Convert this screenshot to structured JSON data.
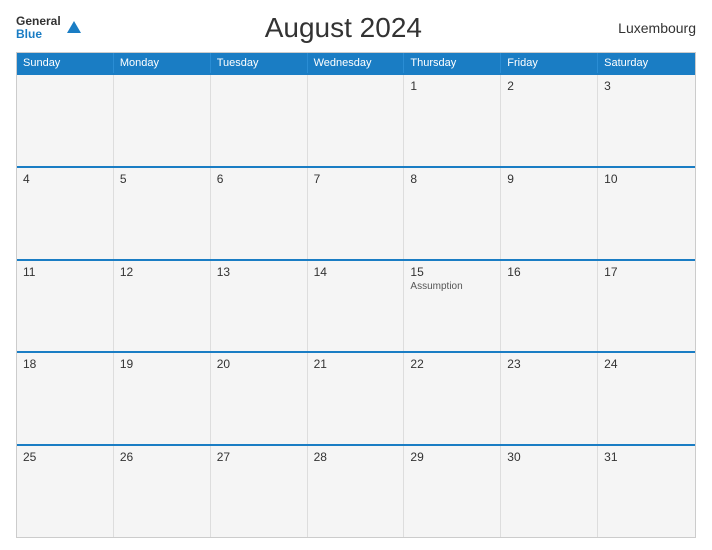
{
  "header": {
    "title": "August 2024",
    "country": "Luxembourg",
    "logo": {
      "general": "General",
      "blue": "Blue"
    }
  },
  "calendar": {
    "days_of_week": [
      "Sunday",
      "Monday",
      "Tuesday",
      "Wednesday",
      "Thursday",
      "Friday",
      "Saturday"
    ],
    "weeks": [
      [
        {
          "day": "",
          "holiday": ""
        },
        {
          "day": "",
          "holiday": ""
        },
        {
          "day": "",
          "holiday": ""
        },
        {
          "day": "",
          "holiday": ""
        },
        {
          "day": "1",
          "holiday": ""
        },
        {
          "day": "2",
          "holiday": ""
        },
        {
          "day": "3",
          "holiday": ""
        }
      ],
      [
        {
          "day": "4",
          "holiday": ""
        },
        {
          "day": "5",
          "holiday": ""
        },
        {
          "day": "6",
          "holiday": ""
        },
        {
          "day": "7",
          "holiday": ""
        },
        {
          "day": "8",
          "holiday": ""
        },
        {
          "day": "9",
          "holiday": ""
        },
        {
          "day": "10",
          "holiday": ""
        }
      ],
      [
        {
          "day": "11",
          "holiday": ""
        },
        {
          "day": "12",
          "holiday": ""
        },
        {
          "day": "13",
          "holiday": ""
        },
        {
          "day": "14",
          "holiday": ""
        },
        {
          "day": "15",
          "holiday": "Assumption"
        },
        {
          "day": "16",
          "holiday": ""
        },
        {
          "day": "17",
          "holiday": ""
        }
      ],
      [
        {
          "day": "18",
          "holiday": ""
        },
        {
          "day": "19",
          "holiday": ""
        },
        {
          "day": "20",
          "holiday": ""
        },
        {
          "day": "21",
          "holiday": ""
        },
        {
          "day": "22",
          "holiday": ""
        },
        {
          "day": "23",
          "holiday": ""
        },
        {
          "day": "24",
          "holiday": ""
        }
      ],
      [
        {
          "day": "25",
          "holiday": ""
        },
        {
          "day": "26",
          "holiday": ""
        },
        {
          "day": "27",
          "holiday": ""
        },
        {
          "day": "28",
          "holiday": ""
        },
        {
          "day": "29",
          "holiday": ""
        },
        {
          "day": "30",
          "holiday": ""
        },
        {
          "day": "31",
          "holiday": ""
        }
      ]
    ]
  }
}
